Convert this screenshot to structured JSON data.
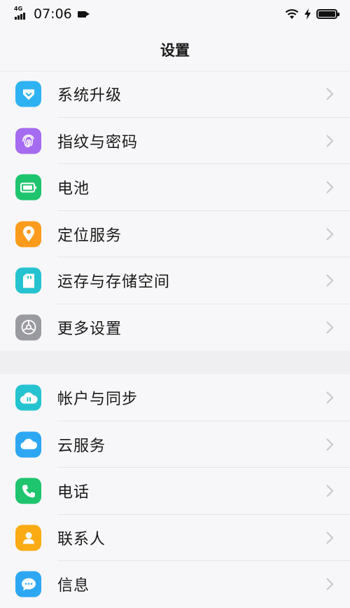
{
  "status_bar": {
    "network": "4G",
    "time": "07:06"
  },
  "header": {
    "title": "设置"
  },
  "groups": [
    {
      "items": [
        {
          "label": "系统升级",
          "icon": "system-upgrade-icon",
          "color": "#2fb2f2"
        },
        {
          "label": "指纹与密码",
          "icon": "fingerprint-icon",
          "color": "#a56bf0"
        },
        {
          "label": "电池",
          "icon": "battery-icon",
          "color": "#1fc46e"
        },
        {
          "label": "定位服务",
          "icon": "location-pin-icon",
          "color": "#fb9b1c"
        },
        {
          "label": "运存与存储空间",
          "icon": "storage-card-icon",
          "color": "#25c3cf"
        },
        {
          "label": "更多设置",
          "icon": "gear-icon",
          "color": "#9a9aa1"
        }
      ]
    },
    {
      "items": [
        {
          "label": "帐户与同步",
          "icon": "cloud-sync-icon",
          "color": "#25c3cf"
        },
        {
          "label": "云服务",
          "icon": "cloud-icon",
          "color": "#2ea7f2"
        },
        {
          "label": "电话",
          "icon": "phone-icon",
          "color": "#1fc46e"
        },
        {
          "label": "联系人",
          "icon": "contact-icon",
          "color": "#fbab14"
        },
        {
          "label": "信息",
          "icon": "message-icon",
          "color": "#2ea7f2"
        }
      ]
    }
  ]
}
